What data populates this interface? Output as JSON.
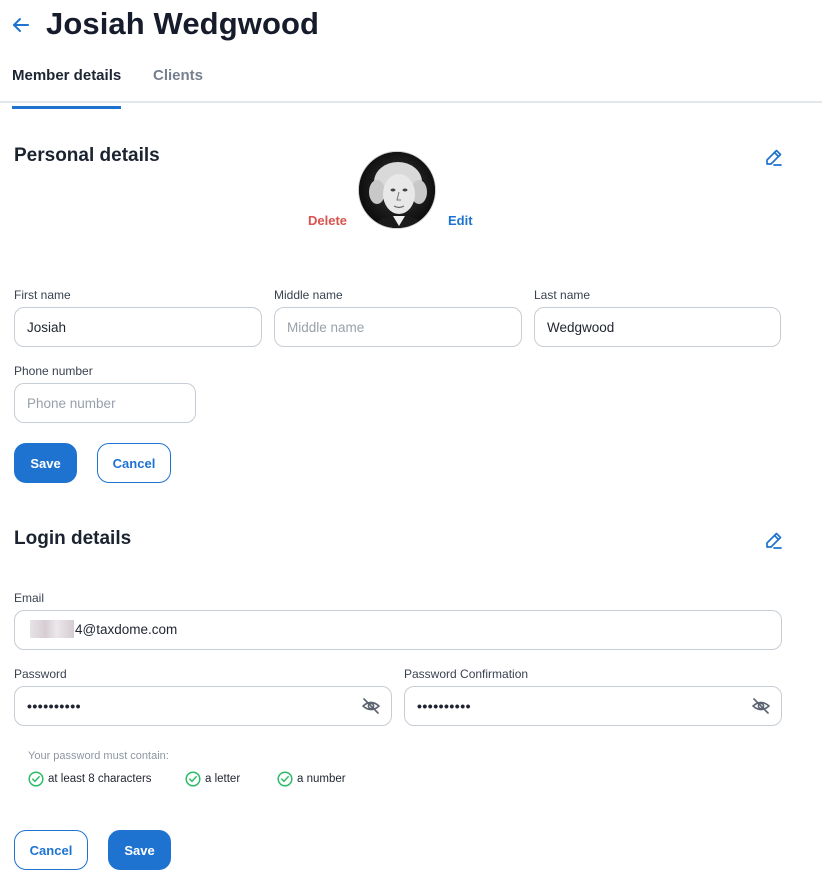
{
  "header": {
    "title": "Josiah Wedgwood",
    "back_icon": "arrow-left-icon"
  },
  "tabs": [
    {
      "label": "Member details",
      "active": true
    },
    {
      "label": "Clients",
      "active": false
    }
  ],
  "personal": {
    "heading": "Personal details",
    "edit_icon": "pencil-icon",
    "photo_delete": "Delete",
    "photo_edit": "Edit",
    "first_name": {
      "label": "First name",
      "value": "Josiah",
      "placeholder": ""
    },
    "middle_name": {
      "label": "Middle name",
      "value": "",
      "placeholder": "Middle name"
    },
    "last_name": {
      "label": "Last name",
      "value": "Wedgwood",
      "placeholder": ""
    },
    "phone": {
      "label": "Phone number",
      "value": "",
      "placeholder": "Phone number"
    },
    "save_label": "Save",
    "cancel_label": "Cancel"
  },
  "login": {
    "heading": "Login details",
    "edit_icon": "pencil-icon",
    "email": {
      "label": "Email",
      "value_visible": "4@taxdome.com"
    },
    "password": {
      "label": "Password",
      "masked_value": "••••••••••"
    },
    "password_confirmation": {
      "label": "Password Confirmation",
      "masked_value": "••••••••••"
    },
    "requirements_title": "Your password must contain:",
    "requirements": [
      "at least 8 characters",
      "a letter",
      "a number"
    ],
    "cancel_label": "Cancel",
    "save_label": "Save"
  },
  "colors": {
    "accent": "#1f73d0",
    "danger": "#d9534f",
    "success": "#2dbb6a"
  }
}
